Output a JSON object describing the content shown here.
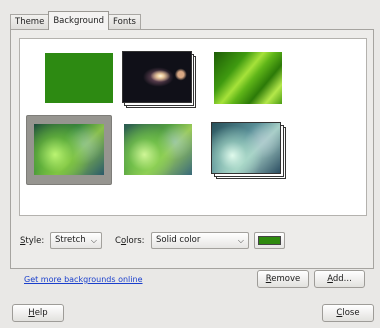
{
  "tabs": [
    {
      "label": "Theme",
      "active": false
    },
    {
      "label": "Background",
      "active": true
    },
    {
      "label": "Fonts",
      "active": false
    }
  ],
  "backgrounds": [
    {
      "name": "green-solid",
      "selected": false,
      "stacked": false
    },
    {
      "name": "galaxy",
      "selected": false,
      "stacked": true
    },
    {
      "name": "green-leaf",
      "selected": false,
      "stacked": false
    },
    {
      "name": "green-bubbles",
      "selected": true,
      "stacked": false
    },
    {
      "name": "green-bubbles-light",
      "selected": false,
      "stacked": false
    },
    {
      "name": "teal-bubbles",
      "selected": false,
      "stacked": true
    }
  ],
  "style": {
    "label_prefix": "S",
    "label_rest": "tyle:",
    "value": "Stretch"
  },
  "colors": {
    "label_prefix": "C",
    "label_u": "o",
    "label_rest": "lors:",
    "value": "Solid color",
    "swatch": "#2e8a0e"
  },
  "links": {
    "get_more": "Get more backgrounds online"
  },
  "buttons": {
    "remove_u": "R",
    "remove_rest": "emove",
    "add_u": "A",
    "add_rest": "dd...",
    "help_u": "H",
    "help_rest": "elp",
    "close_u": "C",
    "close_rest": "lose"
  },
  "colors_theme": {
    "link": "#1a3fcc",
    "selection": "#969590"
  }
}
